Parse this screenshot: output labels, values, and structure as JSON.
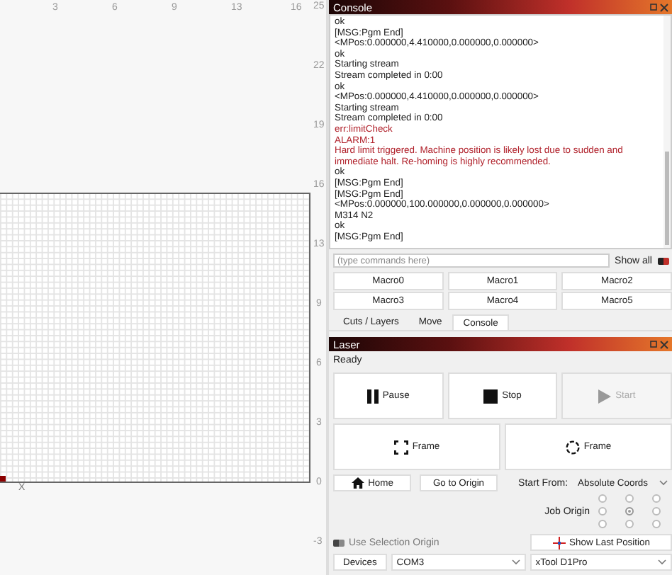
{
  "canvas": {
    "top_labels": [
      "3",
      "6",
      "9",
      "13",
      "16"
    ],
    "right_labels": [
      "25",
      "22",
      "19",
      "16",
      "13",
      "9",
      "6",
      "3",
      "0",
      "-3"
    ],
    "axis_label": "X"
  },
  "console": {
    "title": "Console",
    "lines": [
      {
        "text": "ok",
        "kind": "normal"
      },
      {
        "text": "[MSG:Pgm End]",
        "kind": "normal"
      },
      {
        "text": "<MPos:0.000000,4.410000,0.000000,0.000000>",
        "kind": "normal"
      },
      {
        "text": "ok",
        "kind": "normal"
      },
      {
        "text": "Starting stream",
        "kind": "normal"
      },
      {
        "text": "Stream completed in 0:00",
        "kind": "normal"
      },
      {
        "text": "ok",
        "kind": "normal"
      },
      {
        "text": "<MPos:0.000000,4.410000,0.000000,0.000000>",
        "kind": "normal"
      },
      {
        "text": "Starting stream",
        "kind": "normal"
      },
      {
        "text": "Stream completed in 0:00",
        "kind": "normal"
      },
      {
        "text": "err:limitCheck",
        "kind": "error"
      },
      {
        "text": "ALARM:1",
        "kind": "error"
      },
      {
        "text": "Hard limit triggered. Machine position is likely lost due to sudden and immediate halt. Re-homing is highly recommended.",
        "kind": "error"
      },
      {
        "text": "ok",
        "kind": "normal"
      },
      {
        "text": "[MSG:Pgm End]",
        "kind": "normal"
      },
      {
        "text": "[MSG:Pgm End]",
        "kind": "normal"
      },
      {
        "text": "<MPos:0.000000,100.000000,0.000000,0.000000>",
        "kind": "normal"
      },
      {
        "text": "M314 N2",
        "kind": "normal"
      },
      {
        "text": "ok",
        "kind": "normal"
      },
      {
        "text": "[MSG:Pgm End]",
        "kind": "normal"
      }
    ],
    "command": {
      "placeholder": "(type commands here)"
    },
    "show_all": {
      "label": "Show all",
      "on": true
    },
    "macros": [
      "Macro0",
      "Macro1",
      "Macro2",
      "Macro3",
      "Macro4",
      "Macro5"
    ]
  },
  "tabs": [
    {
      "label": "Cuts / Layers",
      "selected": false
    },
    {
      "label": "Move",
      "selected": false
    },
    {
      "label": "Console",
      "selected": true
    }
  ],
  "laser": {
    "title": "Laser",
    "status": "Ready",
    "buttons": [
      {
        "label": "Pause",
        "kind": "pause",
        "disabled": false
      },
      {
        "label": "Stop",
        "kind": "stop",
        "disabled": false
      },
      {
        "label": "Start",
        "kind": "start",
        "disabled": true
      }
    ],
    "frame_buttons": [
      {
        "label": "Frame",
        "kind": "rect"
      },
      {
        "label": "Frame",
        "kind": "circle"
      }
    ],
    "home": "Home",
    "go_to_origin": "Go to Origin",
    "start_from": {
      "label": "Start From:",
      "value": "Absolute Coords"
    },
    "job_origin": {
      "label": "Job Origin",
      "points": [
        {
          "selected": false
        },
        {
          "selected": false
        },
        {
          "selected": false
        },
        {
          "selected": false
        },
        {
          "selected": true
        },
        {
          "selected": false
        },
        {
          "selected": false
        },
        {
          "selected": false
        },
        {
          "selected": false
        }
      ]
    },
    "use_selection_origin": {
      "label": "Use Selection Origin",
      "on": false
    },
    "show_last_position": "Show Last Position",
    "devices": "Devices",
    "port": "COM3",
    "device": "xTool D1Pro"
  }
}
